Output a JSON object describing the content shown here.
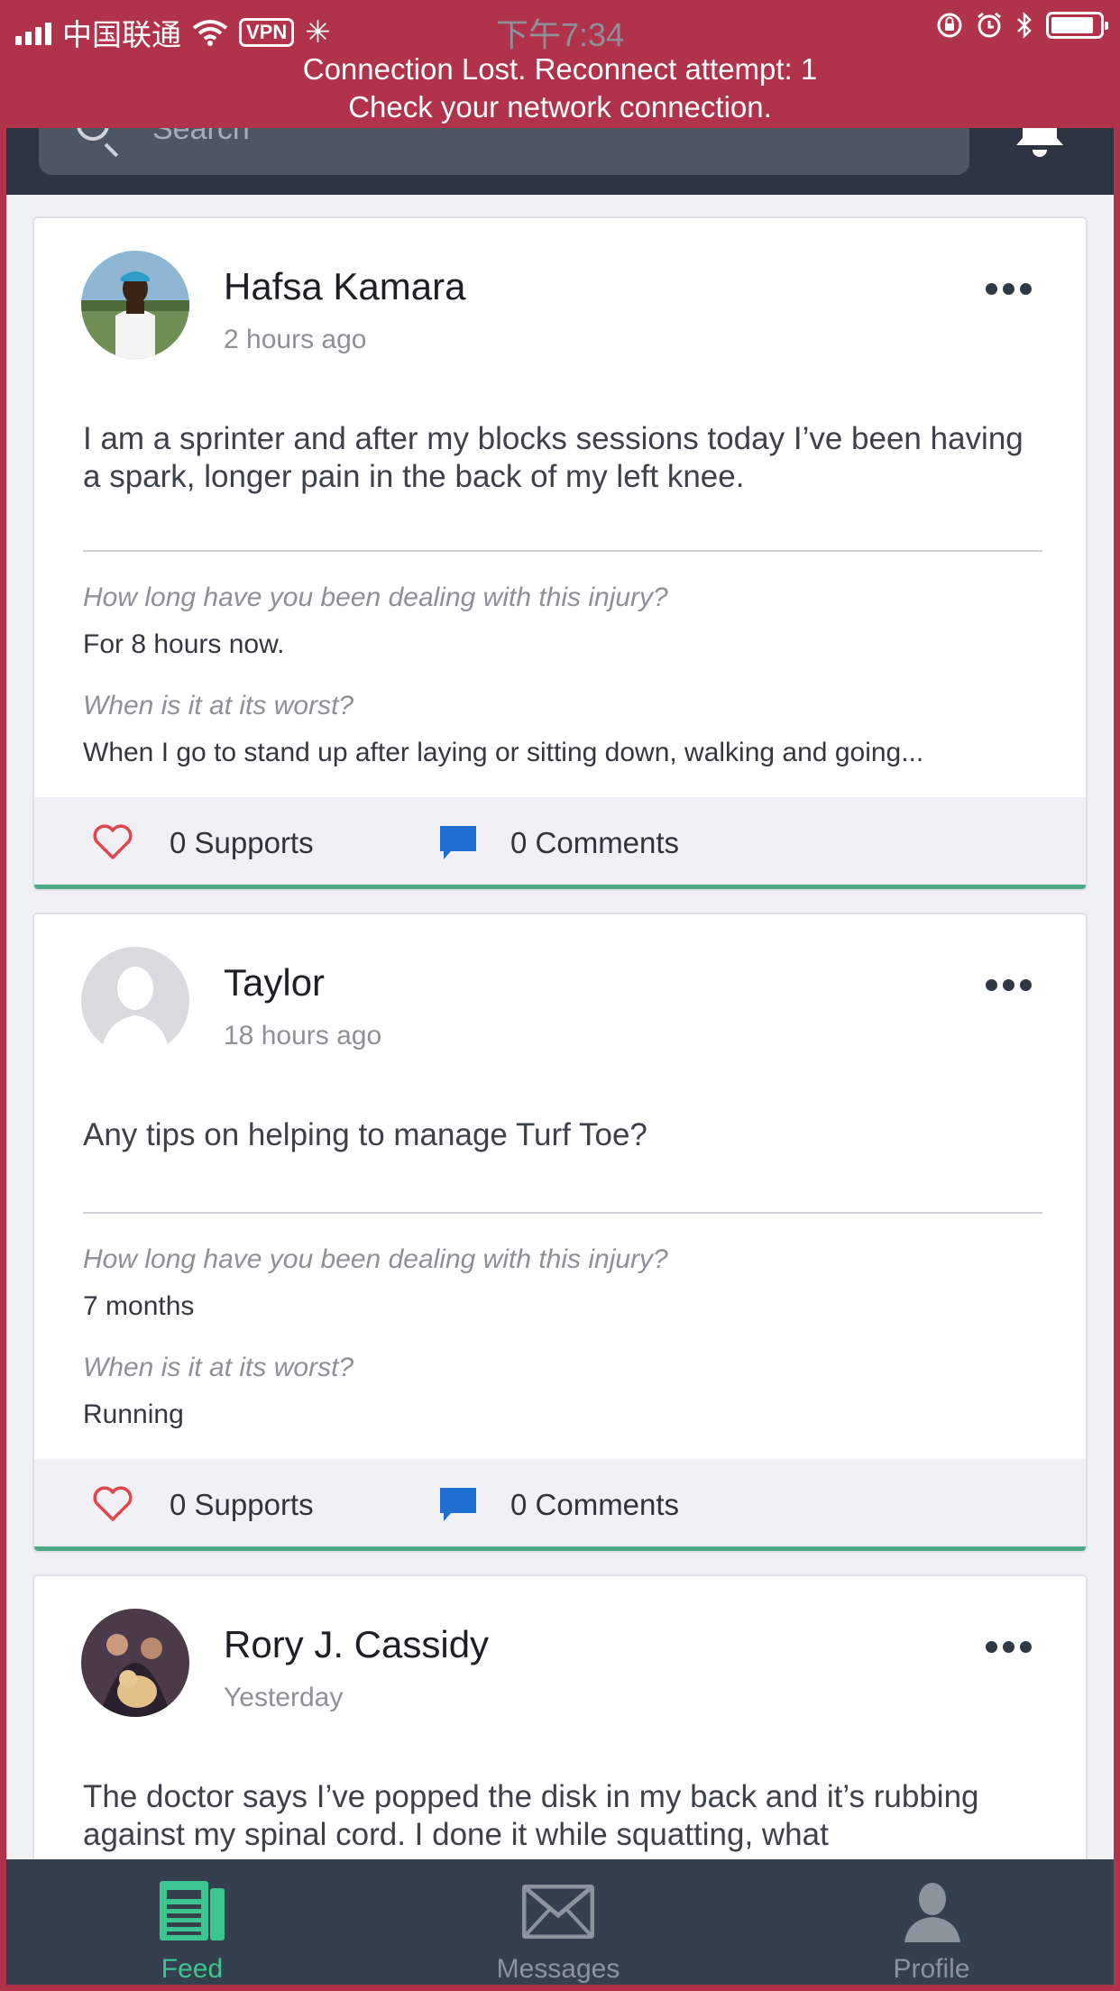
{
  "status_bar": {
    "carrier": "中国联通",
    "vpn_label": "VPN",
    "time": "下午7:34"
  },
  "connection_banner": {
    "line1": "Connection Lost. Reconnect attempt: 1",
    "line2": "Check your network connection."
  },
  "header": {
    "search_placeholder": "Search"
  },
  "posts": [
    {
      "author": "Hafsa Kamara",
      "time": "2 hours ago",
      "body": "I am a sprinter and after my blocks sessions today I’ve been having a spark, longer pain in the back of my left knee.",
      "q1": "How long have you been dealing with this injury?",
      "a1": "For 8 hours now.",
      "q2": "When is it at its worst?",
      "a2": "When I go to stand up after laying or sitting down, walking and going...",
      "supports": "0 Supports",
      "comments": "0 Comments"
    },
    {
      "author": "Taylor",
      "time": "18 hours ago",
      "body": "Any tips on helping to  manage Turf Toe?",
      "q1": "How long have you been dealing with this injury?",
      "a1": "7 months",
      "q2": "When is it at its worst?",
      "a2": "Running",
      "supports": "0 Supports",
      "comments": "0 Comments"
    },
    {
      "author": "Rory J. Cassidy",
      "time": "Yesterday",
      "body": "The doctor says I’ve popped the disk in my back and it’s rubbing against my spinal cord. I done it while squatting, what"
    }
  ],
  "tabs": {
    "feed": "Feed",
    "messages": "Messages",
    "profile": "Profile"
  },
  "colors": {
    "banner": "#b1324b",
    "header": "#2b3440",
    "tabbar": "#34404d",
    "active_tab": "#3cc58f",
    "inactive_tab": "#8b939d",
    "accent_green": "#4fa886",
    "heart": "#e0474c",
    "comment": "#1f6fd3"
  }
}
